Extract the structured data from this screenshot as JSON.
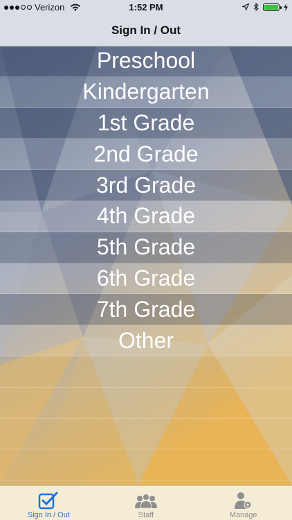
{
  "status_bar": {
    "carrier": "Verizon",
    "time": "1:52 PM",
    "battery_color": "#3cc23c"
  },
  "nav": {
    "title": "Sign In / Out"
  },
  "grades": [
    "Preschool",
    "Kindergarten",
    "1st Grade",
    "2nd Grade",
    "3rd Grade",
    "4th Grade",
    "5th Grade",
    "6th Grade",
    "7th Grade",
    "Other"
  ],
  "tabs": [
    {
      "label": "Sign In / Out",
      "icon": "checkbox-icon",
      "active": true
    },
    {
      "label": "Staff",
      "icon": "people-icon",
      "active": false
    },
    {
      "label": "Manage",
      "icon": "person-gear-icon",
      "active": false
    }
  ],
  "colors": {
    "accent": "#1a73d9",
    "tab_inactive": "#8e8e8e",
    "tab_bar_bg": "#f5ecd6"
  }
}
